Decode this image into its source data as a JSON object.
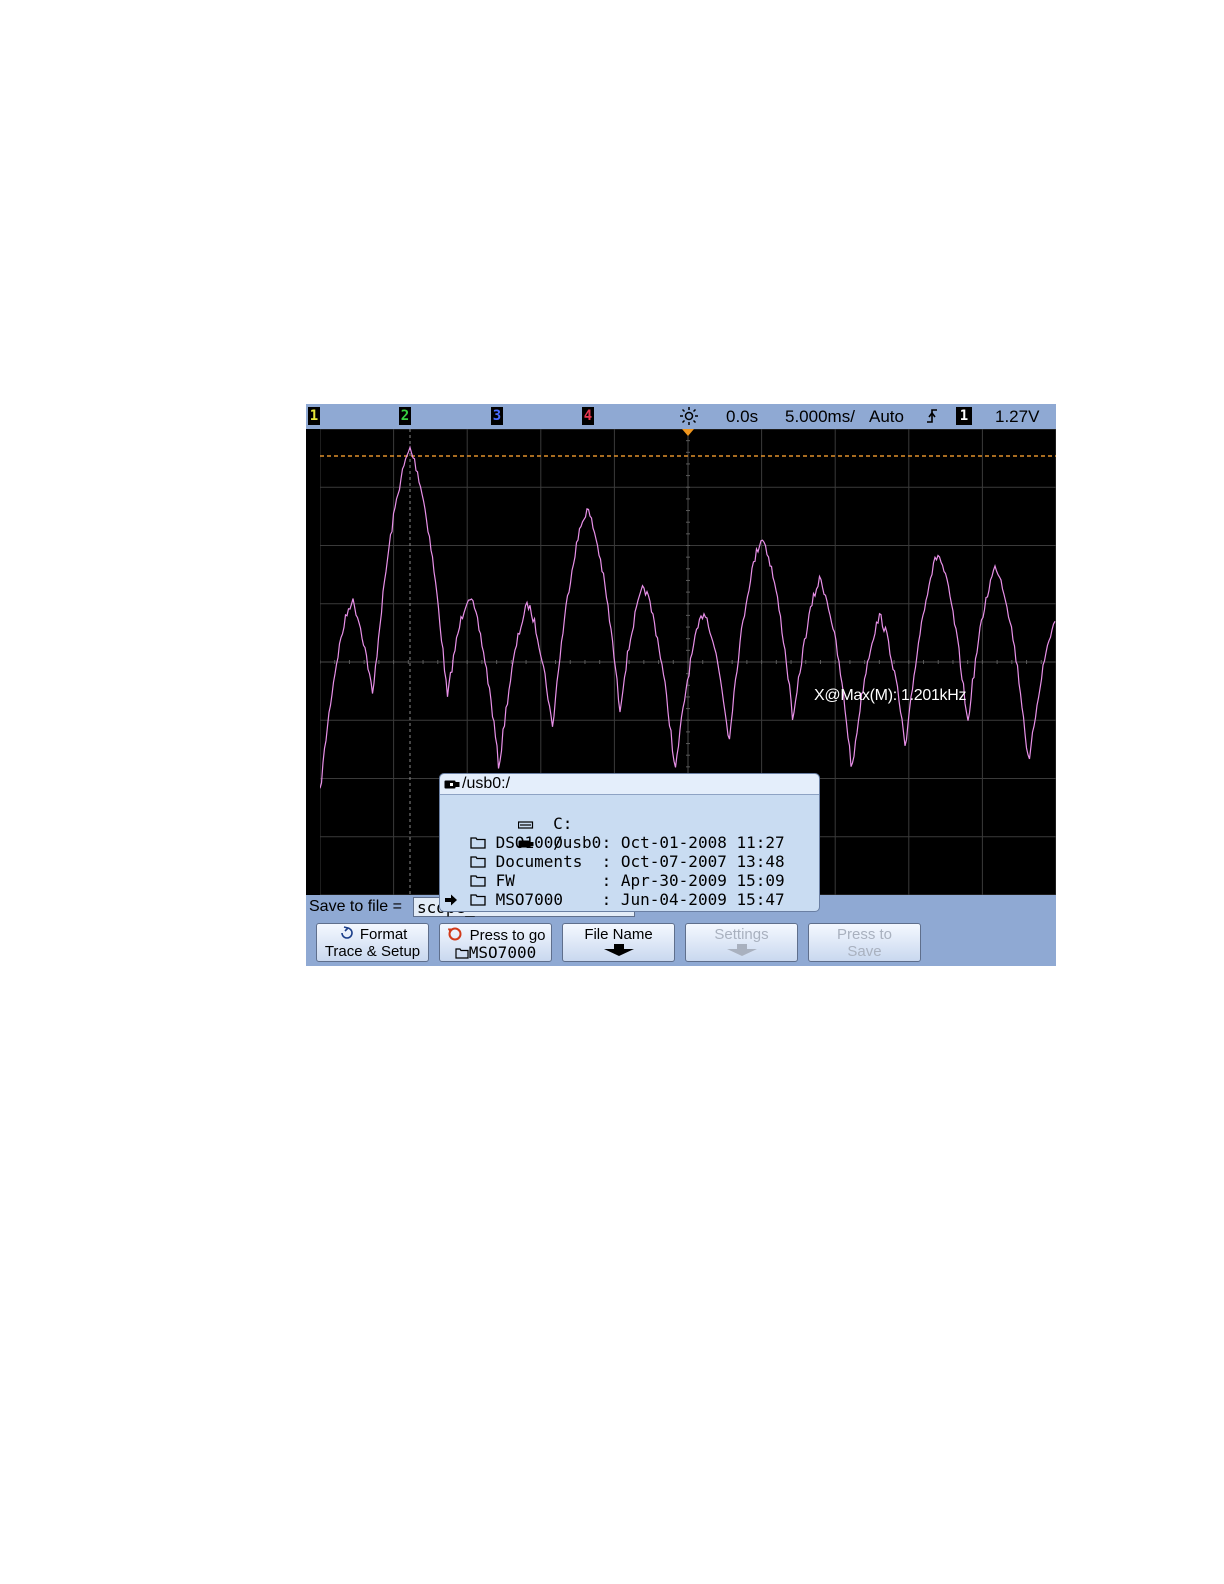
{
  "status_bar": {
    "channels": [
      {
        "label": "1",
        "color": "#e8e83a"
      },
      {
        "label": "2",
        "color": "#37d040"
      },
      {
        "label": "3",
        "color": "#4a6cff"
      },
      {
        "label": "4",
        "color": "#e8364f"
      }
    ],
    "delay": "0.0s",
    "timebase": "5.000ms/",
    "trigger_mode": "Auto",
    "trigger_source": "1",
    "trigger_level": "1.27V"
  },
  "measurement": {
    "text": "X@Max(M): 1.201kHz"
  },
  "trace_color": "#e890e8",
  "save_row": {
    "label": "Save to file =",
    "value": "scope_"
  },
  "file_browser": {
    "path": "/usb0:/",
    "drives": [
      {
        "name": "C:"
      },
      {
        "name": "/usb0"
      }
    ],
    "folders": [
      {
        "name": "DSO1000",
        "date": "Oct-01-2008",
        "time": "11:27",
        "selected": false
      },
      {
        "name": "Documents",
        "date": "Oct-07-2007",
        "time": "13:48",
        "selected": false
      },
      {
        "name": "FW",
        "date": "Apr-30-2009",
        "time": "15:09",
        "selected": false
      },
      {
        "name": "MSO7000",
        "date": "Jun-04-2009",
        "time": "15:47",
        "selected": true
      }
    ]
  },
  "softkeys": [
    {
      "line1": "Format",
      "line2": "Trace & Setup",
      "enabled": true
    },
    {
      "line1": "Press to go",
      "line2": "MSO7000",
      "enabled": true
    },
    {
      "line1": "File Name",
      "line2": "",
      "enabled": true
    },
    {
      "line1": "Settings",
      "line2": "",
      "enabled": false
    },
    {
      "line1": "Press to",
      "line2": "Save",
      "enabled": false
    }
  ]
}
